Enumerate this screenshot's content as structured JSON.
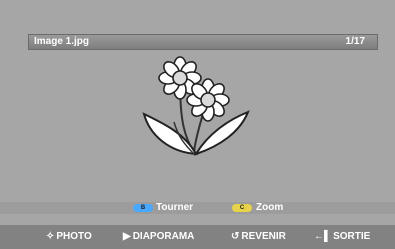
{
  "header": {
    "filename": "Image 1.jpg",
    "counter": "1/17"
  },
  "actions": {
    "rotate": {
      "key": "B",
      "label": "Tourner",
      "key_color": "#4aa8ff"
    },
    "zoom": {
      "key": "C",
      "label": "Zoom",
      "key_color": "#e6d34a"
    }
  },
  "nav": {
    "photo": {
      "icon": "dpad-icon",
      "label": "PHOTO"
    },
    "slideshow": {
      "icon": "play-icon",
      "label": "DIAPORAMA"
    },
    "back": {
      "icon": "return-icon",
      "label": "REVENIR"
    },
    "exit": {
      "icon": "exit-icon",
      "label": "SORTIE"
    }
  }
}
